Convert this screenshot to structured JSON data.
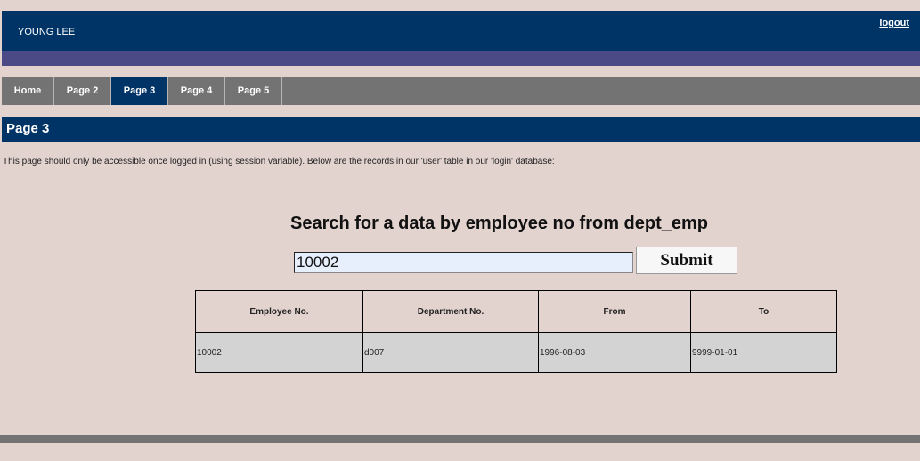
{
  "header": {
    "user_name": "YOUNG LEE",
    "logout_label": "logout"
  },
  "nav": {
    "tabs": [
      {
        "label": "Home"
      },
      {
        "label": "Page 2"
      },
      {
        "label": "Page 3"
      },
      {
        "label": "Page 4"
      },
      {
        "label": "Page 5"
      }
    ],
    "active": "Page 3"
  },
  "page": {
    "title": "Page 3",
    "description": "This page should only be accessible once logged in (using session variable). Below are the records in our 'user' table in our 'login' database:"
  },
  "search": {
    "heading": "Search for a data by employee no from dept_emp",
    "value": "10002",
    "submit_label": "Submit"
  },
  "table": {
    "headers": [
      "Employee No.",
      "Department No.",
      "From",
      "To"
    ],
    "rows": [
      [
        "10002",
        "d007",
        "1996-08-03",
        "9999-01-01"
      ]
    ]
  },
  "colors": {
    "header_bg": "#003366",
    "band": "#4b4a86",
    "nav_bg": "#737373",
    "page_bg": "#e2d3ce",
    "cell_bg": "#d3d3d3"
  }
}
